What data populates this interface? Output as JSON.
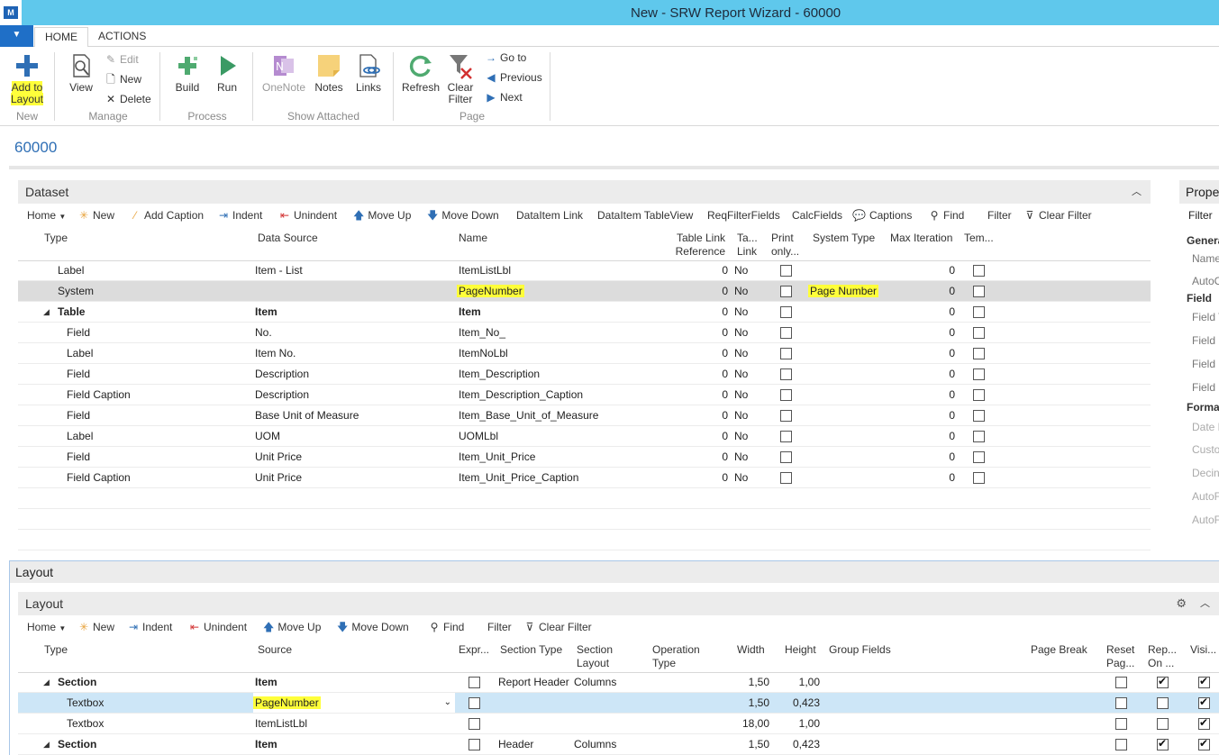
{
  "window": {
    "title": "New - SRW Report Wizard - 60000"
  },
  "tabs": [
    {
      "label": "HOME"
    },
    {
      "label": "ACTIONS"
    }
  ],
  "ribbon": {
    "new_group": {
      "add_to_layout": "Add to Layout",
      "label": "New"
    },
    "manage_group": {
      "view": "View",
      "edit": "Edit",
      "new": "New",
      "delete": "Delete",
      "label": "Manage"
    },
    "process_group": {
      "build": "Build",
      "run": "Run",
      "label": "Process"
    },
    "attached_group": {
      "onenote": "OneNote",
      "notes": "Notes",
      "links": "Links",
      "label": "Show Attached"
    },
    "page_group": {
      "refresh": "Refresh",
      "clear_filter": "Clear Filter",
      "goto": "Go to",
      "previous": "Previous",
      "next": "Next",
      "label": "Page"
    }
  },
  "page_id": "60000",
  "dataset": {
    "title": "Dataset",
    "actions": {
      "home": "Home",
      "new": "New",
      "add_caption": "Add Caption",
      "indent": "Indent",
      "unindent": "Unindent",
      "move_up": "Move Up",
      "move_down": "Move Down",
      "dataitem_link": "DataItem Link",
      "dataitem_tableview": "DataItem TableView",
      "reqfilterfields": "ReqFilterFields",
      "calcfields": "CalcFields",
      "captions": "Captions",
      "find": "Find",
      "filter": "Filter",
      "clear_filter": "Clear Filter"
    },
    "columns": {
      "type": "Type",
      "data_source": "Data Source",
      "name": "Name",
      "table_link_1": "Table Link",
      "table_link_2": "Reference",
      "ta_1": "Ta...",
      "ta_2": "Link",
      "print_1": "Print",
      "print_2": "only...",
      "system_type": "System Type",
      "max_iteration": "Max Iteration",
      "tem": "Tem..."
    },
    "rows": [
      {
        "type": "Label",
        "source": "Item - List",
        "name": "ItemListLbl",
        "ref": "0",
        "link": "No",
        "system_type": "",
        "max": "0",
        "indent": 1
      },
      {
        "type": "System",
        "source": "",
        "name": "PageNumber",
        "ref": "0",
        "link": "No",
        "system_type": "Page Number",
        "max": "0",
        "indent": 1
      },
      {
        "type": "Table",
        "source": "Item",
        "name": "Item",
        "ref": "0",
        "link": "No",
        "system_type": "",
        "max": "0",
        "indent": 0
      },
      {
        "type": "Field",
        "source": "No.",
        "name": "Item_No_",
        "ref": "0",
        "link": "No",
        "system_type": "",
        "max": "0",
        "indent": 2
      },
      {
        "type": "Label",
        "source": "Item No.",
        "name": "ItemNoLbl",
        "ref": "0",
        "link": "No",
        "system_type": "",
        "max": "0",
        "indent": 2
      },
      {
        "type": "Field",
        "source": "Description",
        "name": "Item_Description",
        "ref": "0",
        "link": "No",
        "system_type": "",
        "max": "0",
        "indent": 2
      },
      {
        "type": "Field Caption",
        "source": "Description",
        "name": "Item_Description_Caption",
        "ref": "0",
        "link": "No",
        "system_type": "",
        "max": "0",
        "indent": 2
      },
      {
        "type": "Field",
        "source": "Base Unit of Measure",
        "name": "Item_Base_Unit_of_Measure",
        "ref": "0",
        "link": "No",
        "system_type": "",
        "max": "0",
        "indent": 2
      },
      {
        "type": "Label",
        "source": "UOM",
        "name": "UOMLbl",
        "ref": "0",
        "link": "No",
        "system_type": "",
        "max": "0",
        "indent": 2
      },
      {
        "type": "Field",
        "source": "Unit Price",
        "name": "Item_Unit_Price",
        "ref": "0",
        "link": "No",
        "system_type": "",
        "max": "0",
        "indent": 2
      },
      {
        "type": "Field Caption",
        "source": "Unit Price",
        "name": "Item_Unit_Price_Caption",
        "ref": "0",
        "link": "No",
        "system_type": "",
        "max": "0",
        "indent": 2
      }
    ]
  },
  "properties": {
    "title": "Prope",
    "filter": "Filter",
    "items": [
      "Genera",
      "Name",
      "AutoC",
      "Field",
      "Field T",
      "Field C",
      "Field N",
      "Field C",
      "Forma",
      "Date F",
      "Custo",
      "Decin",
      "AutoF",
      "AutoF"
    ]
  },
  "layout_outer": {
    "title": "Layout"
  },
  "layout": {
    "title": "Layout",
    "actions": {
      "home": "Home",
      "new": "New",
      "indent": "Indent",
      "unindent": "Unindent",
      "move_up": "Move Up",
      "move_down": "Move Down",
      "find": "Find",
      "filter": "Filter",
      "clear_filter": "Clear Filter"
    },
    "columns": {
      "type": "Type",
      "source": "Source",
      "expr": "Expr...",
      "section_type": "Section Type",
      "section_layout_1": "Section",
      "section_layout_2": "Layout",
      "operation_type_1": "Operation",
      "operation_type_2": "Type",
      "width": "Width",
      "height": "Height",
      "group_fields": "Group Fields",
      "page_break": "Page Break",
      "reset_1": "Reset",
      "reset_2": "Pag...",
      "rep_1": "Rep...",
      "rep_2": "On ...",
      "visi": "Visi..."
    },
    "rows": [
      {
        "type": "Section",
        "source": "Item",
        "section_type": "Report Header",
        "section_layout": "Columns",
        "width": "1,50",
        "height": "1,00",
        "rep": true,
        "visi": true
      },
      {
        "type": "Textbox",
        "source": "PageNumber",
        "section_type": "",
        "section_layout": "",
        "width": "1,50",
        "height": "0,423",
        "rep": false,
        "visi": true
      },
      {
        "type": "Textbox",
        "source": "ItemListLbl",
        "section_type": "",
        "section_layout": "",
        "width": "18,00",
        "height": "1,00",
        "rep": false,
        "visi": true
      },
      {
        "type": "Section",
        "source": "Item",
        "section_type": "Header",
        "section_layout": "Columns",
        "width": "1,50",
        "height": "0,423",
        "rep": true,
        "visi": true
      }
    ]
  },
  "colors": {
    "titlebar": "#5fc8ec",
    "accent": "#1f6fc7",
    "highlight": "#ffff3a",
    "selected_row": "#cde6f7"
  }
}
